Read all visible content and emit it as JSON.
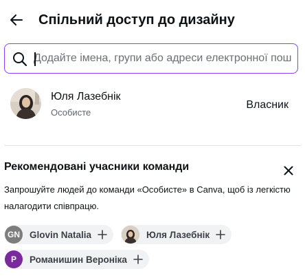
{
  "header": {
    "back_icon": "arrow-left-icon",
    "title": "Спільний доступ до дизайну"
  },
  "search": {
    "icon": "search-icon",
    "value": "",
    "placeholder": "Додайте імена, групи або адреси електронної пош"
  },
  "owner": {
    "name": "Юля Лазебнік",
    "subtitle": "Особисте",
    "role": "Власник"
  },
  "recommended": {
    "title": "Рекомендовані учасники команди",
    "close_icon": "close-icon",
    "description": "Запрошуйте людей до команди «Особисте» в Canva, щоб із легкістю налагодити співпрацю.",
    "chips": [
      {
        "initials": "GN",
        "name": "Glovin Natalia",
        "avatar_color": "#7d7d7d"
      },
      {
        "initials": "",
        "name": "Юля Лазебнік",
        "avatar_color": "#c9b9a8"
      },
      {
        "initials": "P",
        "name": "Романишин Вероніка",
        "avatar_color": "#7a2a9c"
      }
    ],
    "plus_icon": "plus-icon"
  },
  "colors": {
    "accent": "#8b3dff",
    "chip_bg": "#f1f2f4",
    "divider": "#dfe1e4"
  }
}
